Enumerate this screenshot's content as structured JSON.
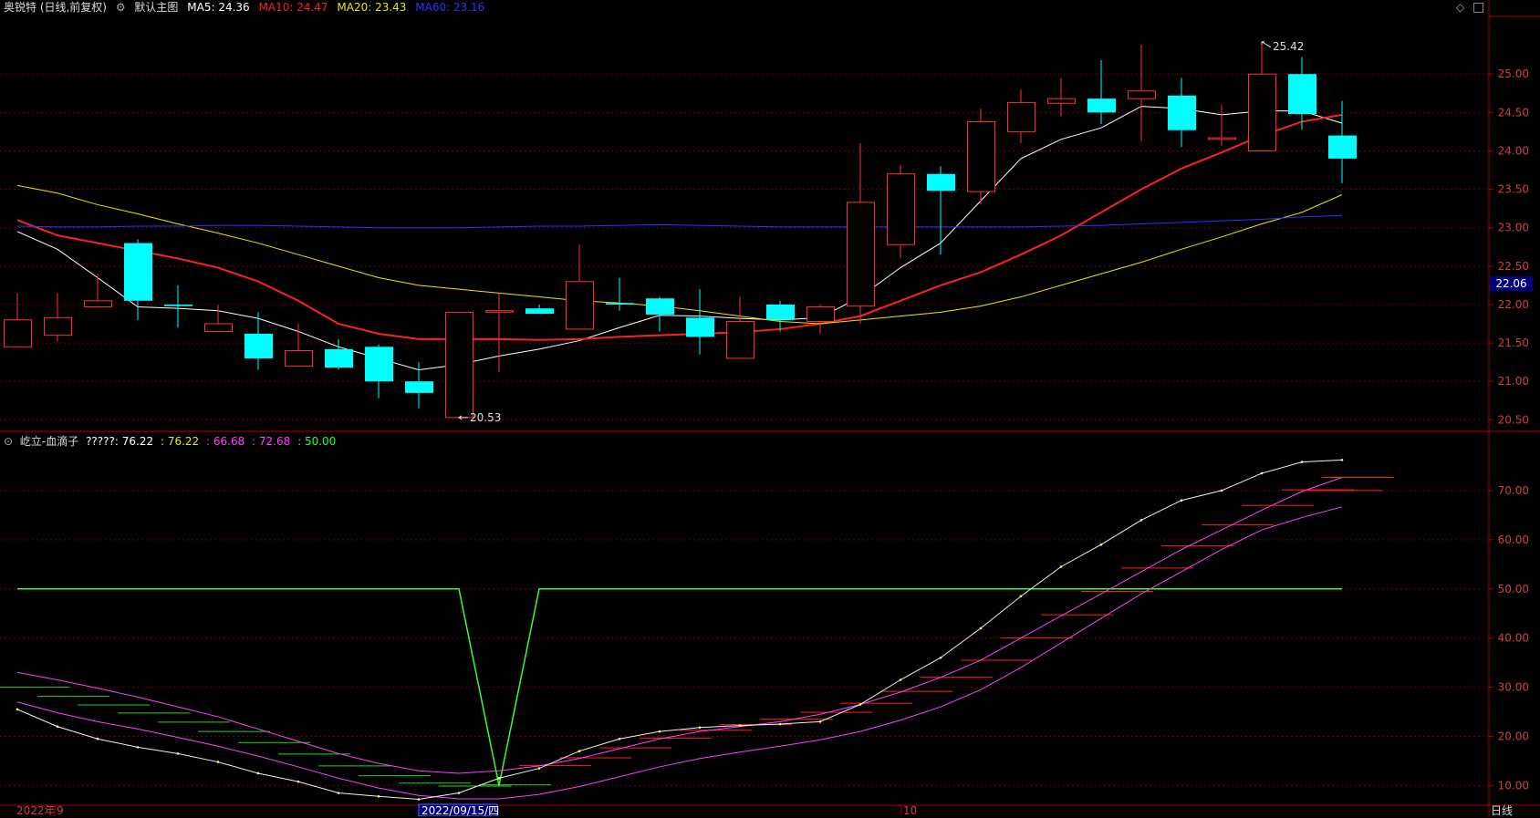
{
  "main": {
    "stock_name": "奥锐特 (日线,前复权)",
    "template_name": "默认主图",
    "ma_labels": [
      {
        "text": "MA5: 24.36",
        "color": "#ffffff"
      },
      {
        "text": "MA10: 24.47",
        "color": "#ff2020"
      },
      {
        "text": "MA20: 23.43",
        "color": "#e8e800"
      },
      {
        "text": "MA60: 23.16",
        "color": "#3030ff"
      }
    ],
    "current_price_tag": "22.06",
    "high_label": "25.42",
    "low_label": "20.53"
  },
  "sub": {
    "indicator_name": "屹立-血滴子",
    "values_label": "?????: 76.22",
    "values": [
      {
        "text": ": 76.22",
        "color": "#e8e800"
      },
      {
        "text": ": 66.68",
        "color": "#ff40ff"
      },
      {
        "text": ": 72.68",
        "color": "#ff40ff"
      },
      {
        "text": ": 50.00",
        "color": "#30ff30"
      }
    ]
  },
  "x_axis": {
    "left_label": "2022年",
    "month_label_1": "9",
    "cursor_date": "2022/09/15/四",
    "month_label_2": "10"
  },
  "period_tab": "日线",
  "icons": {
    "toggle": "diamond-icon",
    "window": "square-icon",
    "sub_collapse": "circle-chevron-icon"
  },
  "chart_data": [
    {
      "type": "candlestick",
      "title": "奥锐特 (日线,前复权)",
      "y_ticks": [
        20.5,
        21.0,
        21.5,
        22.0,
        22.5,
        23.0,
        23.5,
        24.0,
        24.5,
        25.0
      ],
      "ylim": [
        20.35,
        25.75
      ],
      "candles": [
        {
          "o": 21.45,
          "c": 21.8,
          "h": 22.15,
          "l": 21.45
        },
        {
          "o": 21.6,
          "c": 21.83,
          "h": 22.15,
          "l": 21.52
        },
        {
          "o": 21.97,
          "c": 22.05,
          "h": 22.4,
          "l": 21.97
        },
        {
          "o": 22.8,
          "c": 22.05,
          "h": 22.85,
          "l": 21.8
        },
        {
          "o": 22.0,
          "c": 21.98,
          "h": 22.25,
          "l": 21.7
        },
        {
          "o": 21.65,
          "c": 21.75,
          "h": 22.0,
          "l": 21.65
        },
        {
          "o": 21.62,
          "c": 21.3,
          "h": 21.9,
          "l": 21.15
        },
        {
          "o": 21.2,
          "c": 21.4,
          "h": 21.75,
          "l": 21.2
        },
        {
          "o": 21.42,
          "c": 21.18,
          "h": 21.55,
          "l": 21.15
        },
        {
          "o": 21.45,
          "c": 21.0,
          "h": 21.48,
          "l": 20.78
        },
        {
          "o": 21.0,
          "c": 20.85,
          "h": 21.25,
          "l": 20.65
        },
        {
          "o": 20.53,
          "c": 21.9,
          "h": 21.9,
          "l": 20.53
        },
        {
          "o": 21.92,
          "c": 21.92,
          "h": 22.15,
          "l": 21.12
        },
        {
          "o": 21.95,
          "c": 21.88,
          "h": 22.0,
          "l": 21.88
        },
        {
          "o": 21.68,
          "c": 22.3,
          "h": 22.78,
          "l": 21.68
        },
        {
          "o": 22.02,
          "c": 22.0,
          "h": 22.35,
          "l": 21.92
        },
        {
          "o": 22.08,
          "c": 21.87,
          "h": 22.1,
          "l": 21.65
        },
        {
          "o": 21.83,
          "c": 21.58,
          "h": 22.2,
          "l": 21.35
        },
        {
          "o": 21.3,
          "c": 21.78,
          "h": 22.1,
          "l": 21.3
        },
        {
          "o": 22.0,
          "c": 21.8,
          "h": 22.05,
          "l": 21.65
        },
        {
          "o": 21.78,
          "c": 21.97,
          "h": 22.0,
          "l": 21.62
        },
        {
          "o": 21.98,
          "c": 23.33,
          "h": 24.1,
          "l": 21.75
        },
        {
          "o": 22.78,
          "c": 23.7,
          "h": 23.82,
          "l": 22.6
        },
        {
          "o": 23.7,
          "c": 23.48,
          "h": 23.8,
          "l": 22.65
        },
        {
          "o": 23.47,
          "c": 24.38,
          "h": 24.55,
          "l": 23.3
        },
        {
          "o": 24.25,
          "c": 24.63,
          "h": 24.8,
          "l": 24.1
        },
        {
          "o": 24.62,
          "c": 24.68,
          "h": 24.95,
          "l": 24.45
        },
        {
          "o": 24.68,
          "c": 24.5,
          "h": 25.18,
          "l": 24.35
        },
        {
          "o": 24.68,
          "c": 24.78,
          "h": 25.38,
          "l": 24.12
        },
        {
          "o": 24.72,
          "c": 24.27,
          "h": 24.95,
          "l": 24.05
        },
        {
          "o": 24.15,
          "c": 24.17,
          "h": 24.6,
          "l": 24.07
        },
        {
          "o": 24.0,
          "c": 25.0,
          "h": 25.42,
          "l": 24.0
        },
        {
          "o": 25.0,
          "c": 24.48,
          "h": 25.22,
          "l": 24.28
        },
        {
          "o": 24.2,
          "c": 23.9,
          "h": 24.65,
          "l": 23.58
        }
      ],
      "series": [
        {
          "name": "MA5",
          "color": "#ffffff",
          "values": [
            22.95,
            22.72,
            22.35,
            21.97,
            21.95,
            21.92,
            21.82,
            21.65,
            21.45,
            21.3,
            21.15,
            21.22,
            21.33,
            21.42,
            21.53,
            21.7,
            21.86,
            21.85,
            21.82,
            21.8,
            21.83,
            22.1,
            22.48,
            22.8,
            23.35,
            23.9,
            24.15,
            24.3,
            24.58,
            24.55,
            24.47,
            24.52,
            24.52,
            24.36
          ]
        },
        {
          "name": "MA10",
          "color": "#ff2020",
          "values": [
            23.1,
            22.9,
            22.8,
            22.7,
            22.6,
            22.48,
            22.3,
            22.05,
            21.75,
            21.62,
            21.55,
            21.55,
            21.55,
            21.54,
            21.55,
            21.58,
            21.6,
            21.62,
            21.64,
            21.68,
            21.75,
            21.85,
            22.05,
            22.25,
            22.42,
            22.65,
            22.9,
            23.2,
            23.5,
            23.77,
            23.98,
            24.2,
            24.38,
            24.47
          ]
        },
        {
          "name": "MA20",
          "color": "#e8e800",
          "values": [
            23.55,
            23.45,
            23.3,
            23.18,
            23.05,
            22.93,
            22.8,
            22.65,
            22.5,
            22.35,
            22.25,
            22.2,
            22.15,
            22.1,
            22.05,
            22.02,
            21.98,
            21.92,
            21.85,
            21.78,
            21.75,
            21.8,
            21.85,
            21.9,
            21.98,
            22.1,
            22.25,
            22.4,
            22.55,
            22.72,
            22.88,
            23.05,
            23.2,
            23.43
          ]
        },
        {
          "name": "MA60",
          "color": "#3030ff",
          "values": [
            23.02,
            23.01,
            23.01,
            23.02,
            23.02,
            23.03,
            23.03,
            23.02,
            23.01,
            23.0,
            23.0,
            23.0,
            23.01,
            23.02,
            23.02,
            23.03,
            23.04,
            23.03,
            23.02,
            23.01,
            23.01,
            23.01,
            23.01,
            23.01,
            23.01,
            23.01,
            23.02,
            23.03,
            23.05,
            23.07,
            23.09,
            23.11,
            23.14,
            23.16
          ]
        }
      ]
    },
    {
      "type": "line",
      "title": "屹立-血滴子",
      "y_ticks": [
        10,
        20,
        30,
        40,
        50,
        60,
        70
      ],
      "ylim": [
        6,
        80
      ],
      "series": [
        {
          "name": "?????",
          "color": "#ffffff",
          "values": [
            25.5,
            22,
            19.5,
            17.8,
            16.5,
            14.8,
            12.5,
            10.8,
            8.5,
            7.8,
            7.2,
            8.5,
            11.5,
            13.5,
            17,
            19.5,
            21,
            21.8,
            22.2,
            22.5,
            23,
            26.5,
            31.5,
            36,
            42,
            48.5,
            54.5,
            59,
            64,
            68,
            70,
            73.5,
            75.8,
            76.22
          ]
        },
        {
          "name": "Line2",
          "color": "#ff40ff",
          "values": [
            33,
            31.5,
            29.8,
            28,
            26,
            24,
            21.5,
            19,
            16.5,
            14.5,
            13,
            12.5,
            13,
            14,
            15.5,
            17.5,
            19.5,
            21,
            22,
            23,
            24.5,
            26.5,
            29,
            32,
            35.5,
            40,
            44.5,
            49,
            53.5,
            58,
            62,
            66,
            69.8,
            72.68
          ]
        },
        {
          "name": "Line3",
          "color": "#ff40ff",
          "values": [
            27,
            24.8,
            23,
            21.5,
            19.8,
            18,
            16,
            13.8,
            11.5,
            9.5,
            8,
            7.3,
            7.3,
            8.2,
            9.8,
            11.8,
            13.8,
            15.5,
            16.8,
            18,
            19.3,
            21,
            23.3,
            26,
            29.5,
            34,
            39,
            44,
            49,
            53.5,
            58,
            62,
            64.5,
            66.68
          ]
        },
        {
          "name": "Line4",
          "color": "#30ff30",
          "values": [
            50,
            50,
            50,
            50,
            50,
            50,
            50,
            50,
            50,
            50,
            50,
            50,
            10,
            50,
            50,
            50,
            50,
            50,
            50,
            50,
            50,
            50,
            50,
            50,
            50,
            50,
            50,
            50,
            50,
            50,
            50,
            50,
            50,
            50
          ]
        }
      ]
    }
  ]
}
